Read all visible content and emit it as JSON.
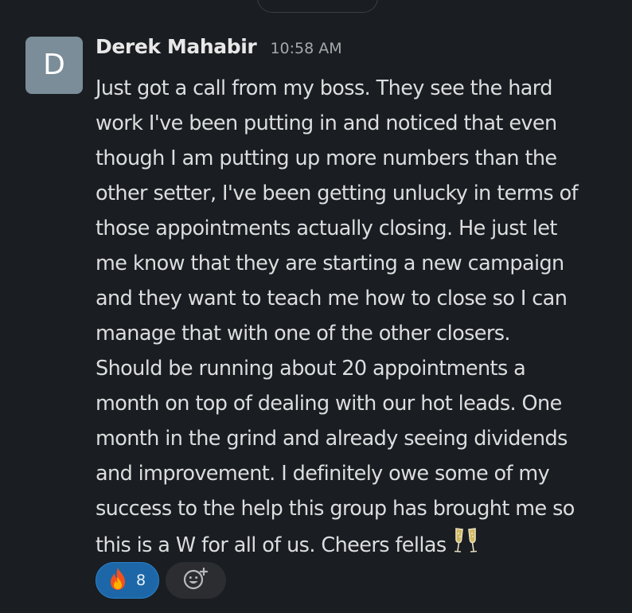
{
  "message": {
    "avatar_initial": "D",
    "author": "Derek Mahabir",
    "timestamp": "10:58 AM",
    "lines": [
      "Just got a call from my boss. They see the hard",
      "work I've been putting in and noticed that even",
      "though I am putting up more numbers than the",
      "other setter, I've been getting unlucky in terms of",
      "those appointments actually closing. He just let",
      "me know that they are starting a new campaign",
      "and they want to teach me how to close so I can",
      "manage that with one of the other closers.",
      "Should be running about 20 appointments a",
      "month on top of dealing with our hot leads. One",
      "month in the grind and already seeing dividends",
      "and improvement. I definitely owe some of my",
      "success to the help this group has brought me so",
      "this is a W for all of us. Cheers fellas"
    ],
    "emoji": "clinking-glasses-icon"
  },
  "reactions": [
    {
      "emoji": "fire-icon",
      "count": "8"
    }
  ],
  "add_reaction_icon": "add-emoji-icon",
  "colors": {
    "background": "#1a1d21",
    "text": "#dcddde",
    "reaction_active": "#1d67a8",
    "avatar": "#7a8d98"
  }
}
